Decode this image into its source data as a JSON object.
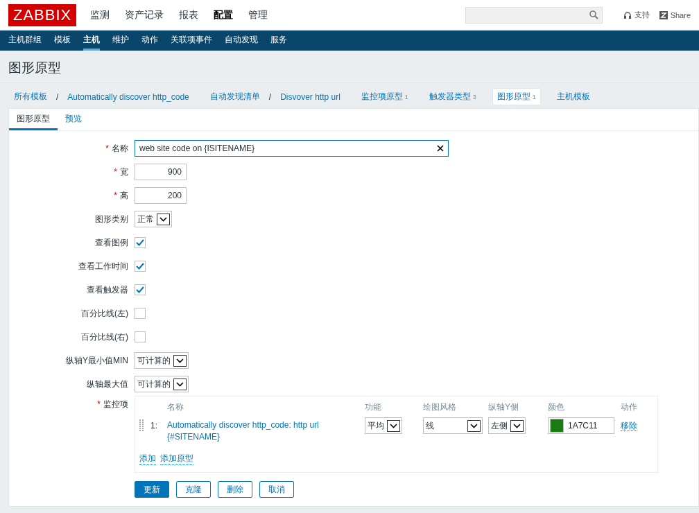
{
  "header": {
    "logo": "ZABBIX",
    "menu": [
      {
        "label": "监测",
        "selected": false
      },
      {
        "label": "资产记录",
        "selected": false
      },
      {
        "label": "报表",
        "selected": false
      },
      {
        "label": "配置",
        "selected": true
      },
      {
        "label": "管理",
        "selected": false
      }
    ],
    "links": [
      {
        "kind": "headset",
        "label": "支持"
      },
      {
        "kind": "share",
        "label": "Share"
      }
    ]
  },
  "subnav": [
    {
      "label": "主机群组",
      "selected": false
    },
    {
      "label": "模板",
      "selected": false
    },
    {
      "label": "主机",
      "selected": true
    },
    {
      "label": "维护",
      "selected": false
    },
    {
      "label": "动作",
      "selected": false
    },
    {
      "label": "关联项事件",
      "selected": false
    },
    {
      "label": "自动发现",
      "selected": false
    },
    {
      "label": "服务",
      "selected": false
    }
  ],
  "page_title": "图形原型",
  "breadcrumbs": [
    {
      "label": "所有模板",
      "sep": "/",
      "selected": false
    },
    {
      "label": "Automatically discover http_code",
      "selected": false
    },
    {
      "label": "自动发现清单",
      "sep": "/",
      "selected": false
    },
    {
      "label": "Disvover http url",
      "selected": false
    },
    {
      "label": "监控项原型",
      "count": "1",
      "selected": false
    },
    {
      "label": "触发器类型",
      "count": "3",
      "selected": false
    },
    {
      "label": "图形原型",
      "count": "1",
      "selected": true
    },
    {
      "label": "主机模板",
      "selected": false
    }
  ],
  "tabs": [
    {
      "label": "图形原型",
      "selected": true
    },
    {
      "label": "预览",
      "selected": false
    }
  ],
  "fields": [
    {
      "kind": "text",
      "required_mark": "*",
      "label": "名称",
      "value": "web site code on {ISITENAME}"
    },
    {
      "kind": "number",
      "required_mark": "*",
      "label": "宽",
      "value": "900"
    },
    {
      "kind": "number",
      "required_mark": "*",
      "label": "高",
      "value": "200"
    },
    {
      "kind": "select",
      "label": "图形类别",
      "value": "正常"
    },
    {
      "kind": "checkbox",
      "label": "查看图例",
      "checked": true
    },
    {
      "kind": "checkbox",
      "label": "查看工作时间",
      "checked": true
    },
    {
      "kind": "checkbox",
      "label": "查看触发器",
      "checked": true
    },
    {
      "kind": "checkbox",
      "label": "百分比线(左)",
      "checked": false
    },
    {
      "kind": "checkbox",
      "label": "百分比线(右)",
      "checked": false
    },
    {
      "kind": "select",
      "label": "纵轴Y最小值MIN",
      "value": "可计算的"
    },
    {
      "kind": "select",
      "label": "纵轴最大值",
      "value": "可计算的"
    },
    {
      "kind": "items",
      "required_mark": "*",
      "label": "监控项"
    }
  ],
  "items_table": {
    "columns": [
      "名称",
      "功能",
      "绘图风格",
      "纵轴Y侧",
      "颜色",
      "动作"
    ],
    "rows": [
      {
        "index": "1:",
        "name": "Automatically discover http_code: http url {#SITENAME}",
        "function": "平均",
        "style": "线",
        "axis": "左侧",
        "color_code": "1A7C11",
        "color": "#1a7c11",
        "action": "移除"
      }
    ],
    "links": [
      "添加",
      "添加原型"
    ]
  },
  "buttons": [
    {
      "label": "更新",
      "primary": true
    },
    {
      "label": "克隆",
      "primary": false
    },
    {
      "label": "删除",
      "primary": false
    },
    {
      "label": "取消",
      "primary": false
    }
  ]
}
